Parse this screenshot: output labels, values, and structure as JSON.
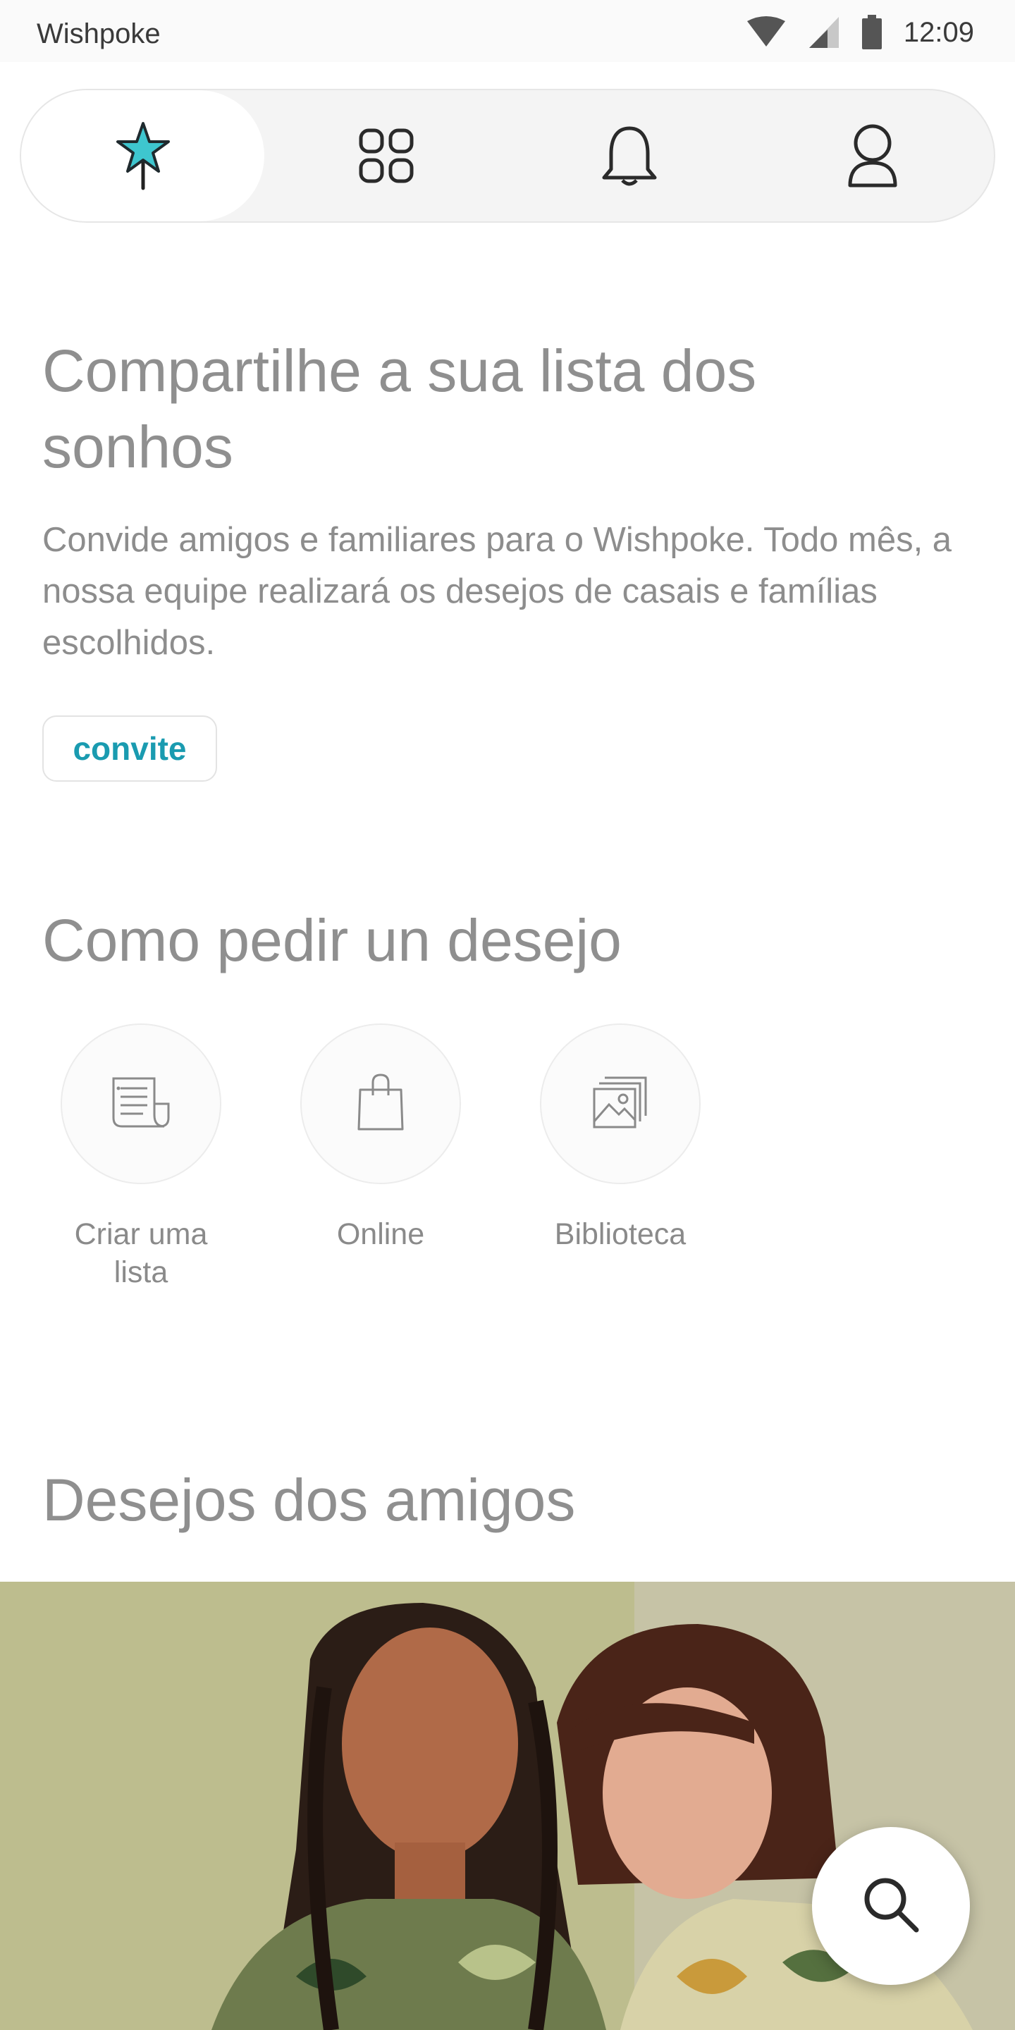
{
  "status_bar": {
    "app_name": "Wishpoke",
    "time": "12:09",
    "icons": [
      "wifi-icon",
      "cellular-signal-icon",
      "battery-icon"
    ]
  },
  "nav": {
    "tabs": [
      {
        "name": "tab-wishes",
        "icon": "wand-star-icon",
        "active": true
      },
      {
        "name": "tab-categories",
        "icon": "grid-icon",
        "active": false
      },
      {
        "name": "tab-notifications",
        "icon": "bell-icon",
        "active": false
      },
      {
        "name": "tab-profile",
        "icon": "user-icon",
        "active": false
      }
    ]
  },
  "invite": {
    "title": "Compartilhe a sua lista dos sonhos",
    "text": "Convide amigos e familiares para o Wishpoke. Todo mês, a nossa equipe realizará os desejos de casais e famílias escolhidos.",
    "button_label": "convite"
  },
  "how": {
    "title": "Como pedir un desejo",
    "items": [
      {
        "label": "Criar uma lista",
        "icon": "list-document-icon"
      },
      {
        "label": "Online",
        "icon": "shopping-bag-icon"
      },
      {
        "label": "Biblioteca",
        "icon": "image-gallery-icon"
      }
    ]
  },
  "friends": {
    "title": "Desejos dos amigos"
  },
  "fab": {
    "icon": "search-icon"
  },
  "colors": {
    "accent": "#1a9bb0",
    "star_fill": "#3ec6cf",
    "headline": "#8f8f8f",
    "nav_bg": "#f4f4f4"
  }
}
